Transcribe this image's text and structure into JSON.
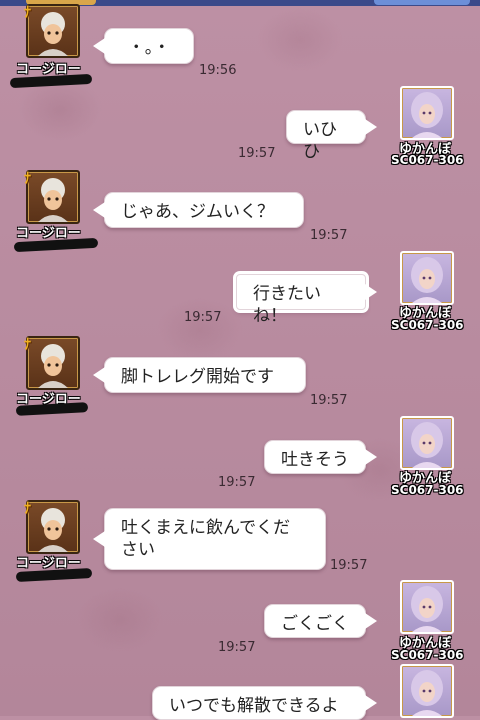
{
  "contacts": {
    "partner": {
      "name": "コージロー"
    },
    "self": {
      "name": "ゆかんぼ",
      "id": "SC067-306"
    }
  },
  "messages": [
    {
      "sender": "partner",
      "text": "・。・",
      "time": "19:56"
    },
    {
      "sender": "self",
      "text": "いひひ",
      "time": "19:57"
    },
    {
      "sender": "partner",
      "text": "じゃあ、ジムいく？",
      "time": "19:57"
    },
    {
      "sender": "self",
      "text": "行きたいね！",
      "time": "19:57"
    },
    {
      "sender": "partner",
      "text": "脚トレレグ開始です",
      "time": "19:57"
    },
    {
      "sender": "self",
      "text": "吐きそう",
      "time": "19:57"
    },
    {
      "sender": "partner",
      "text_line1": "吐くまえに飲んでくだ",
      "text_line2": "さい",
      "time": "19:57"
    },
    {
      "sender": "self",
      "text": "ごくごく",
      "time": "19:57"
    },
    {
      "sender": "self",
      "text": "いつでも解散できるよ"
    }
  ],
  "icons": {
    "rank_badge": "rank-badge-icon",
    "male_avatar": "warrior-avatar-icon",
    "female_avatar": "dancer-avatar-icon"
  },
  "colors": {
    "background": "#b88a9e",
    "bubble": "#ffffff",
    "name_text": "#ffffff"
  }
}
